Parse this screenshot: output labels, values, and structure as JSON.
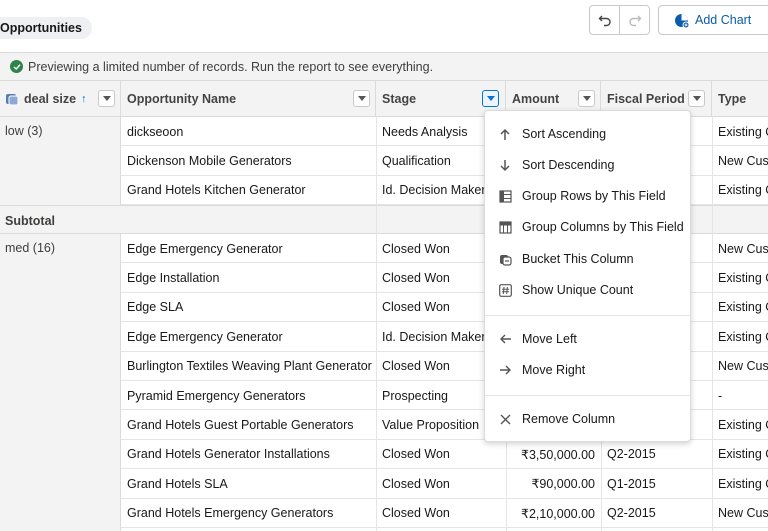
{
  "header": {
    "report_title": "Opportunities",
    "undo_label": "Undo",
    "redo_label": "Redo",
    "add_chart_label": "Add Chart"
  },
  "banner": {
    "message": "Previewing a limited number of records. Run the report to see everything."
  },
  "columns": {
    "group_by": "deal size",
    "opportunity_name": "Opportunity Name",
    "stage": "Stage",
    "amount": "Amount",
    "fiscal_period": "Fiscal Period",
    "type": "Type"
  },
  "groups": [
    {
      "label": "low (3)"
    },
    {
      "label": "med (16)"
    }
  ],
  "subtotal_label": "Subtotal",
  "rows_low": [
    {
      "name": "dickseoon",
      "stage": "Needs Analysis",
      "amount": "",
      "fiscal": "",
      "type": "Existing C"
    },
    {
      "name": "Dickenson Mobile Generators",
      "stage": "Qualification",
      "amount": "",
      "fiscal": "",
      "type": "New Cust"
    },
    {
      "name": "Grand Hotels Kitchen Generator",
      "stage": "Id. Decision Maker",
      "amount": "",
      "fiscal": "",
      "type": "Existing C"
    }
  ],
  "rows_med": [
    {
      "name": "Edge Emergency Generator",
      "stage": "Closed Won",
      "amount": "",
      "fiscal": "",
      "type": "New Cust"
    },
    {
      "name": "Edge Installation",
      "stage": "Closed Won",
      "amount": "",
      "fiscal": "",
      "type": "Existing C"
    },
    {
      "name": "Edge SLA",
      "stage": "Closed Won",
      "amount": "",
      "fiscal": "",
      "type": "Existing C"
    },
    {
      "name": "Edge Emergency Generator",
      "stage": "Id. Decision Maker",
      "amount": "",
      "fiscal": "",
      "type": "Existing C"
    },
    {
      "name": "Burlington Textiles Weaving Plant Generator",
      "stage": "Closed Won",
      "amount": "",
      "fiscal": "",
      "type": "New Cust"
    },
    {
      "name": "Pyramid Emergency Generators",
      "stage": "Prospecting",
      "amount": "",
      "fiscal": "",
      "type": "-"
    },
    {
      "name": "Grand Hotels Guest Portable Generators",
      "stage": "Value Proposition",
      "amount": "",
      "fiscal": "",
      "type": "Existing C"
    },
    {
      "name": "Grand Hotels Generator Installations",
      "stage": "Closed Won",
      "amount": "₹3,50,000.00",
      "fiscal": "Q2-2015",
      "type": "Existing C"
    },
    {
      "name": "Grand Hotels SLA",
      "stage": "Closed Won",
      "amount": "₹90,000.00",
      "fiscal": "Q1-2015",
      "type": "Existing C"
    },
    {
      "name": "Grand Hotels Emergency Generators",
      "stage": "Closed Won",
      "amount": "₹2,10,000.00",
      "fiscal": "Q2-2015",
      "type": "New Cust"
    }
  ],
  "menu": {
    "sort_asc": "Sort Ascending",
    "sort_desc": "Sort Descending",
    "group_rows": "Group Rows by This Field",
    "group_cols": "Group Columns by This Field",
    "bucket": "Bucket This Column",
    "unique_count": "Show Unique Count",
    "move_left": "Move Left",
    "move_right": "Move Right",
    "remove": "Remove Column"
  },
  "colors": {
    "accent": "#0176d3",
    "success": "#2e844a",
    "brand_link": "#0b5cab"
  }
}
